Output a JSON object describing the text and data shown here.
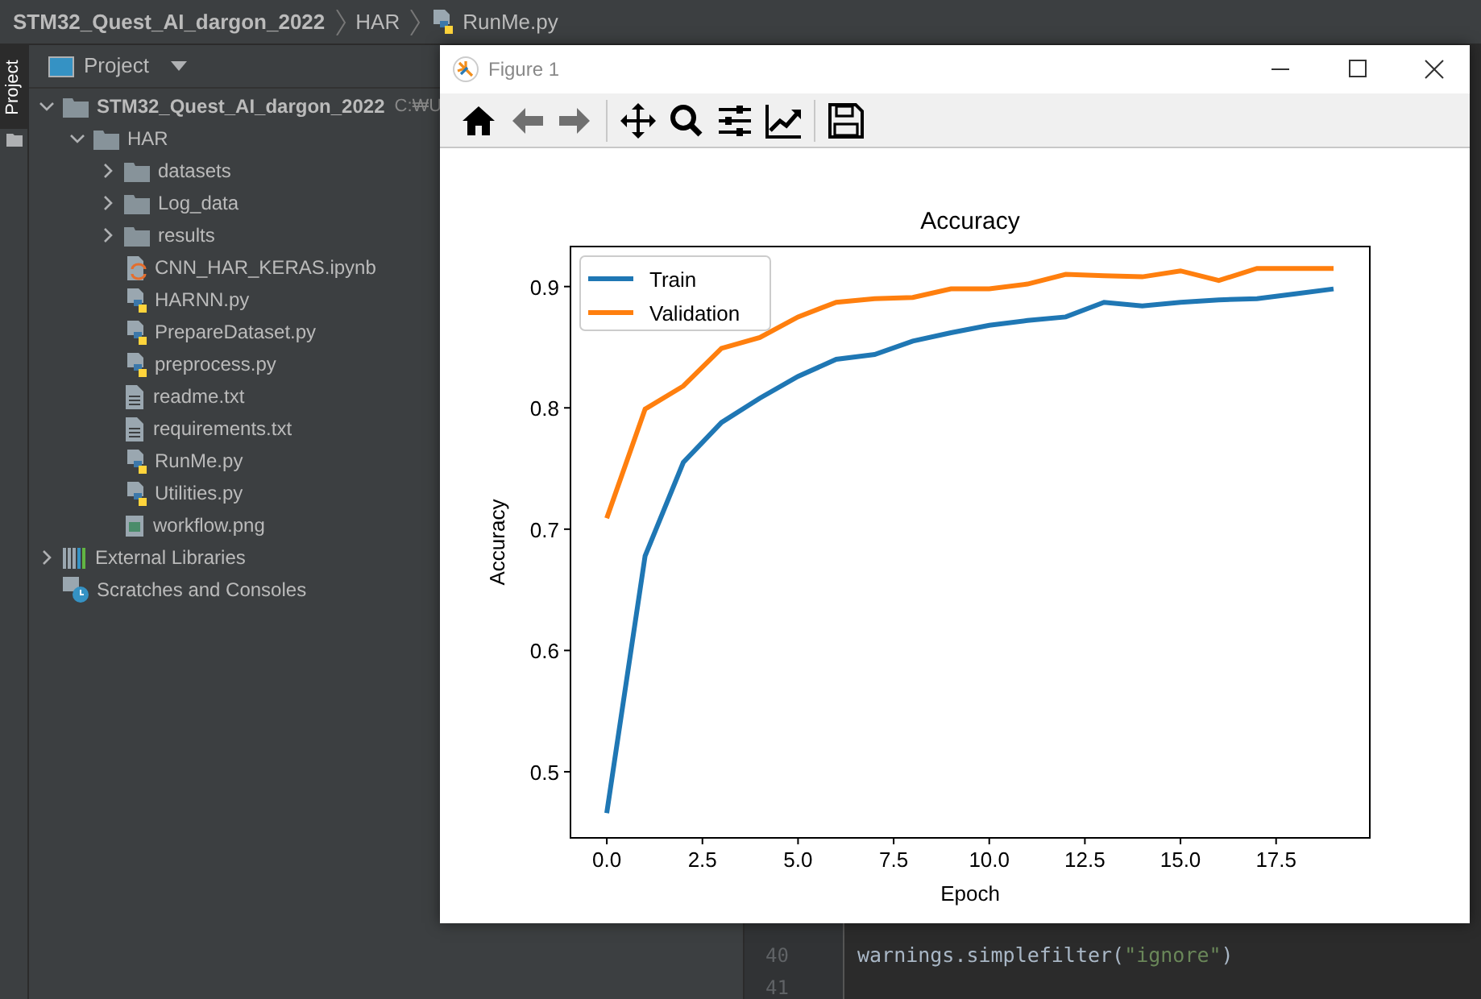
{
  "breadcrumb": [
    {
      "kind": "project",
      "text": "STM32_Quest_AI_dargon_2022"
    },
    {
      "kind": "folder",
      "text": "HAR"
    },
    {
      "kind": "python",
      "text": "RunMe.py"
    }
  ],
  "tool_strip": [
    {
      "label": "Project",
      "selected": true
    }
  ],
  "project_panel": {
    "title": "Project",
    "tree": [
      {
        "kind": "folder",
        "label": "STM32_Quest_AI_dargon_2022",
        "path_hint": "C:₩U",
        "expanded": true,
        "children": [
          {
            "kind": "folder",
            "label": "HAR",
            "expanded": true,
            "children": [
              {
                "kind": "folder",
                "label": "datasets",
                "expanded": false
              },
              {
                "kind": "folder",
                "label": "Log_data",
                "expanded": false
              },
              {
                "kind": "folder",
                "label": "results",
                "expanded": false
              },
              {
                "kind": "notebook",
                "label": "CNN_HAR_KERAS.ipynb"
              },
              {
                "kind": "python",
                "label": "HARNN.py"
              },
              {
                "kind": "python",
                "label": "PrepareDataset.py"
              },
              {
                "kind": "python",
                "label": "preprocess.py"
              },
              {
                "kind": "text",
                "label": "readme.txt"
              },
              {
                "kind": "text",
                "label": "requirements.txt"
              },
              {
                "kind": "python",
                "label": "RunMe.py"
              },
              {
                "kind": "python",
                "label": "Utilities.py"
              },
              {
                "kind": "image",
                "label": "workflow.png"
              }
            ]
          }
        ]
      },
      {
        "kind": "libraries",
        "label": "External Libraries",
        "expanded": false
      },
      {
        "kind": "scratches",
        "label": "Scratches and Consoles"
      }
    ]
  },
  "editor": {
    "lines": [
      {
        "number": "40",
        "segments": [
          {
            "kind": "plain",
            "text": "warnings.simplefilter("
          },
          {
            "kind": "string",
            "text": "\"ignore\""
          },
          {
            "kind": "plain",
            "text": ")"
          }
        ]
      },
      {
        "number": "41"
      }
    ]
  },
  "figure_window": {
    "title": "Figure 1",
    "toolbar": [
      {
        "kind": "home",
        "disabled": false
      },
      {
        "kind": "back",
        "disabled": true
      },
      {
        "kind": "forward",
        "disabled": true
      },
      {
        "kind": "separator"
      },
      {
        "kind": "pan",
        "disabled": false
      },
      {
        "kind": "zoom",
        "disabled": false
      },
      {
        "kind": "configure",
        "disabled": false
      },
      {
        "kind": "edit",
        "disabled": false
      },
      {
        "kind": "separator"
      },
      {
        "kind": "save",
        "disabled": false
      }
    ],
    "chart_data": {
      "type": "line",
      "title": "Accuracy",
      "xlabel": "Epoch",
      "ylabel": "Accuracy",
      "x": [
        0,
        1,
        2,
        3,
        4,
        5,
        6,
        7,
        8,
        9,
        10,
        11,
        12,
        13,
        14,
        15,
        16,
        17,
        18,
        19
      ],
      "series": [
        {
          "name": "Train",
          "color": "#1f77b4",
          "values": [
            0.466,
            0.678,
            0.755,
            0.788,
            0.808,
            0.826,
            0.84,
            0.844,
            0.855,
            0.862,
            0.868,
            0.872,
            0.875,
            0.887,
            0.884,
            0.887,
            0.889,
            0.89,
            0.894,
            0.898
          ]
        },
        {
          "name": "Validation",
          "color": "#ff7f0e",
          "values": [
            0.709,
            0.799,
            0.818,
            0.849,
            0.858,
            0.875,
            0.887,
            0.89,
            0.891,
            0.898,
            0.898,
            0.902,
            0.91,
            0.909,
            0.908,
            0.913,
            0.905,
            0.915,
            0.915,
            0.915
          ]
        }
      ],
      "legend": true,
      "xlim": [
        -0.95,
        19.95
      ],
      "ylim": [
        0.4455,
        0.933
      ],
      "xticks": [
        {
          "value": 0,
          "label": "0.0"
        },
        {
          "value": 2.5,
          "label": "2.5"
        },
        {
          "value": 5,
          "label": "5.0"
        },
        {
          "value": 7.5,
          "label": "7.5"
        },
        {
          "value": 10,
          "label": "10.0"
        },
        {
          "value": 12.5,
          "label": "12.5"
        },
        {
          "value": 15,
          "label": "15.0"
        },
        {
          "value": 17.5,
          "label": "17.5"
        }
      ],
      "yticks": [
        {
          "value": 0.5,
          "label": "0.5"
        },
        {
          "value": 0.6,
          "label": "0.6"
        },
        {
          "value": 0.7,
          "label": "0.7"
        },
        {
          "value": 0.8,
          "label": "0.8"
        },
        {
          "value": 0.9,
          "label": "0.9"
        }
      ]
    }
  }
}
